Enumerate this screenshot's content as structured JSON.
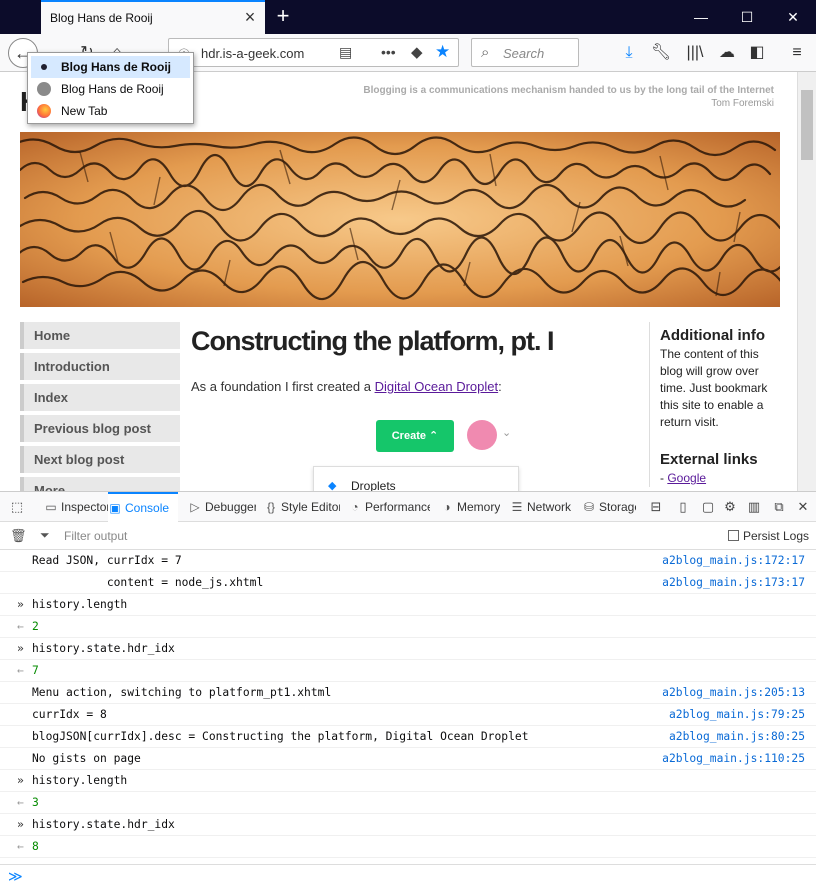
{
  "browser": {
    "tab_title": "Blog Hans de Rooij",
    "url": "hdr.is-a-geek.com",
    "search_placeholder": "Search"
  },
  "history_popup": [
    {
      "label": "Blog Hans de Rooij",
      "selected": true
    },
    {
      "label": "Blog Hans de Rooij",
      "selected": false
    },
    {
      "label": "New Tab",
      "selected": false
    }
  ],
  "page": {
    "site_title": "Hans de Rooij's Blog",
    "site_title_visible": "H               m",
    "tagline": "Blogging is a communications mechanism handed to us by the long tail of the Internet",
    "tagline_author": "Tom Foremski",
    "nav": [
      "Home",
      "Introduction",
      "Index",
      "Previous blog post",
      "Next blog post",
      "More . . ."
    ],
    "post_title": "Constructing the platform, pt. I",
    "post_intro": "As a foundation I first created a ",
    "post_link": "Digital Ocean Droplet",
    "post_after": ":",
    "do_create": "Create",
    "do_dropdown": "Droplets",
    "aside_title": "Additional info",
    "aside_text": "The content of this blog will grow over time. Just bookmark this site to enable a return visit.",
    "aside_links_title": "External links",
    "aside_link_prefix": "- ",
    "aside_link": "Google"
  },
  "devtools": {
    "tabs": [
      "Inspector",
      "Console",
      "Debugger",
      "Style Editor",
      "Performance",
      "Memory",
      "Network",
      "Storage"
    ],
    "filter_placeholder": "Filter output",
    "persist_logs": "Persist Logs",
    "logs": [
      {
        "kind": "log",
        "text": "Read JSON, currIdx = 7",
        "src": "a2blog_main.js:172:17"
      },
      {
        "kind": "log",
        "text": "           content = node_js.xhtml",
        "src": "a2blog_main.js:173:17"
      },
      {
        "kind": "input",
        "text": "history.length",
        "src": ""
      },
      {
        "kind": "result",
        "text": "2",
        "src": ""
      },
      {
        "kind": "input",
        "text": "history.state.hdr_idx",
        "src": ""
      },
      {
        "kind": "result",
        "text": "7",
        "src": ""
      },
      {
        "kind": "log",
        "text": "Menu action, switching to platform_pt1.xhtml",
        "src": "a2blog_main.js:205:13"
      },
      {
        "kind": "log",
        "text": "currIdx = 8",
        "src": "a2blog_main.js:79:25"
      },
      {
        "kind": "log",
        "text": "blogJSON[currIdx].desc = Constructing the platform, Digital Ocean Droplet",
        "src": "a2blog_main.js:80:25"
      },
      {
        "kind": "log",
        "text": "No gists on page",
        "src": "a2blog_main.js:110:25"
      },
      {
        "kind": "input",
        "text": "history.length",
        "src": ""
      },
      {
        "kind": "result",
        "text": "3",
        "src": ""
      },
      {
        "kind": "input",
        "text": "history.state.hdr_idx",
        "src": ""
      },
      {
        "kind": "result",
        "text": "8",
        "src": ""
      }
    ]
  },
  "colors": {
    "accent": "#0a84ff",
    "tabbar": "#0c0c2a",
    "do_green": "#15c66a",
    "link": "#0a6ad6"
  }
}
